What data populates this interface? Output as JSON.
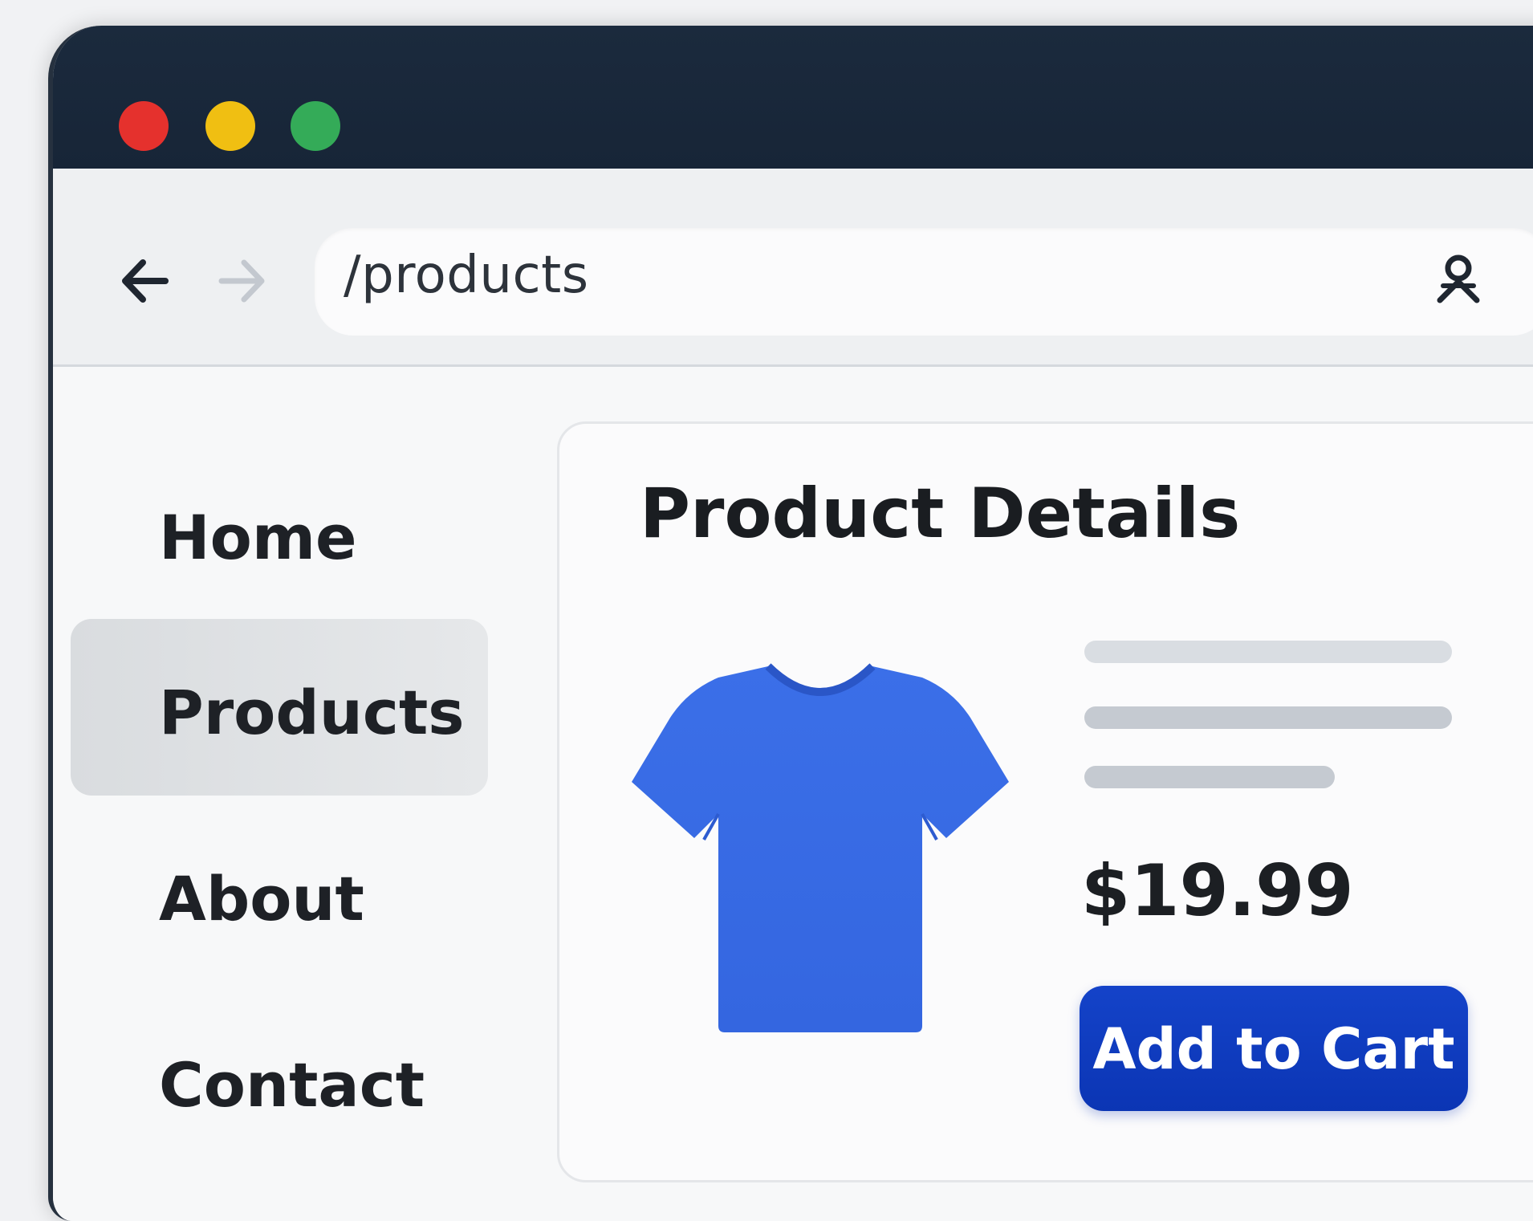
{
  "window": {
    "controls": [
      "close",
      "minimize",
      "maximize"
    ]
  },
  "toolbar": {
    "back_icon": "arrow-left-icon",
    "forward_icon": "arrow-right-icon",
    "url": "/products",
    "profile_icon": "user-profile-icon"
  },
  "sidebar": {
    "items": [
      {
        "label": "Home",
        "active": false
      },
      {
        "label": "Products",
        "active": true
      },
      {
        "label": "About",
        "active": false
      },
      {
        "label": "Contact",
        "active": false
      }
    ]
  },
  "product": {
    "title": "Product Details",
    "image_icon": "tshirt-icon",
    "price": "$19.99",
    "add_to_cart_label": "Add to Cart"
  },
  "colors": {
    "titlebar": "#1b2a3d",
    "close": "#e5312d",
    "minimize": "#f0bf12",
    "maximize": "#34ab58",
    "accent": "#1443c9",
    "product": "#3a6ce6"
  }
}
